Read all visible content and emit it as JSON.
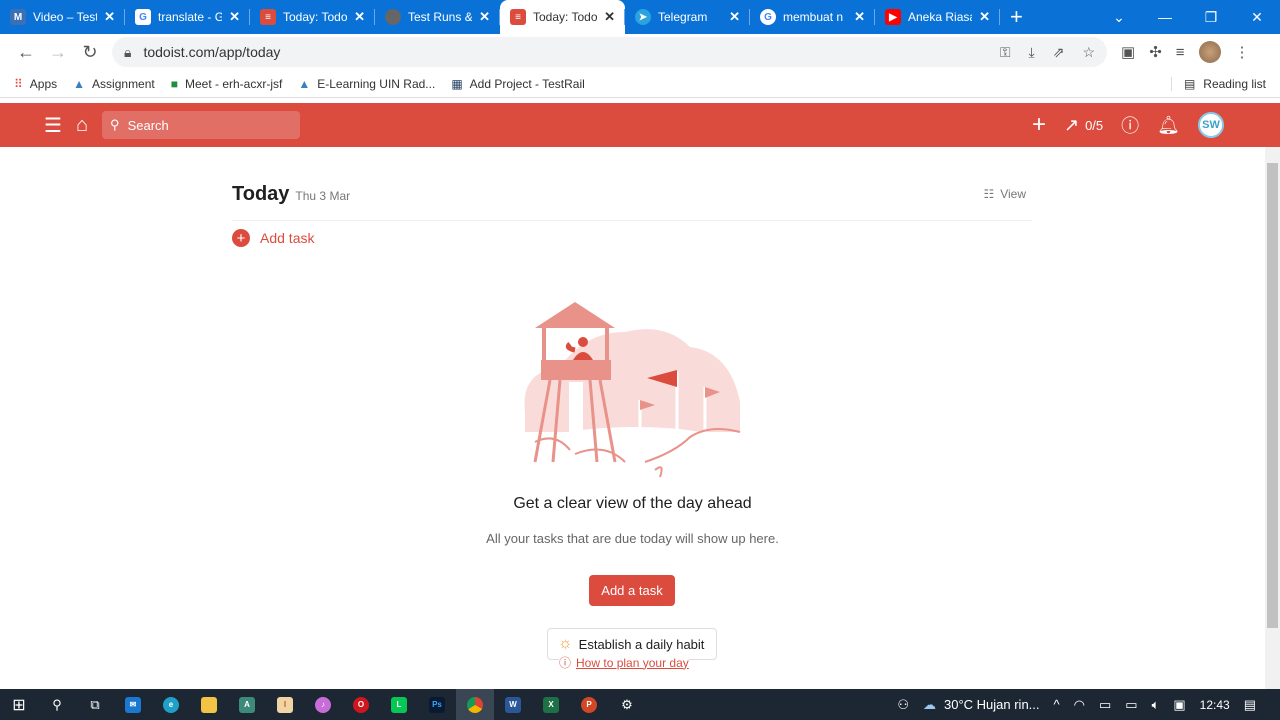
{
  "browser": {
    "tabs": [
      {
        "title": "Video – Test",
        "icon": "M",
        "color": "#3b6fb6"
      },
      {
        "title": "translate - Google",
        "icon": "G",
        "color": "#ffffff"
      },
      {
        "title": "Today: Todoist",
        "icon": "todoist",
        "color": "#db4c3f"
      },
      {
        "title": "Test Runs & Results",
        "icon": "globe",
        "color": "#666666"
      },
      {
        "title": "Today: Todoist",
        "icon": "todoist",
        "color": "#db4c3f",
        "active": true
      },
      {
        "title": "Telegram",
        "icon": "telegram",
        "color": "#2aa3e0"
      },
      {
        "title": "membuat n",
        "icon": "G",
        "color": "#ffffff"
      },
      {
        "title": "Aneka Riasan",
        "icon": "youtube",
        "color": "#ff0000"
      }
    ],
    "url": "todoist.com/app/today",
    "bookmarks": [
      "Apps",
      "Assignment",
      "Meet - erh-acxr-jsf",
      "E-Learning UIN Rad...",
      "Add Project - TestRail"
    ],
    "reading_list": "Reading list"
  },
  "todoist": {
    "search_placeholder": "Search",
    "karma": "0/5",
    "avatar": "SW",
    "title": "Today",
    "date": "Thu 3 Mar",
    "view": "View",
    "add_task": "Add task",
    "empty_title": "Get a clear view of the day ahead",
    "empty_sub": "All your tasks that are due today will show up here.",
    "cta": "Add a task",
    "habit": "Establish a daily habit",
    "howto": "How to plan your day",
    "brand_color": "#db4c3f"
  },
  "taskbar": {
    "weather": "30°C  Hujan rin...",
    "time": "12:43"
  }
}
